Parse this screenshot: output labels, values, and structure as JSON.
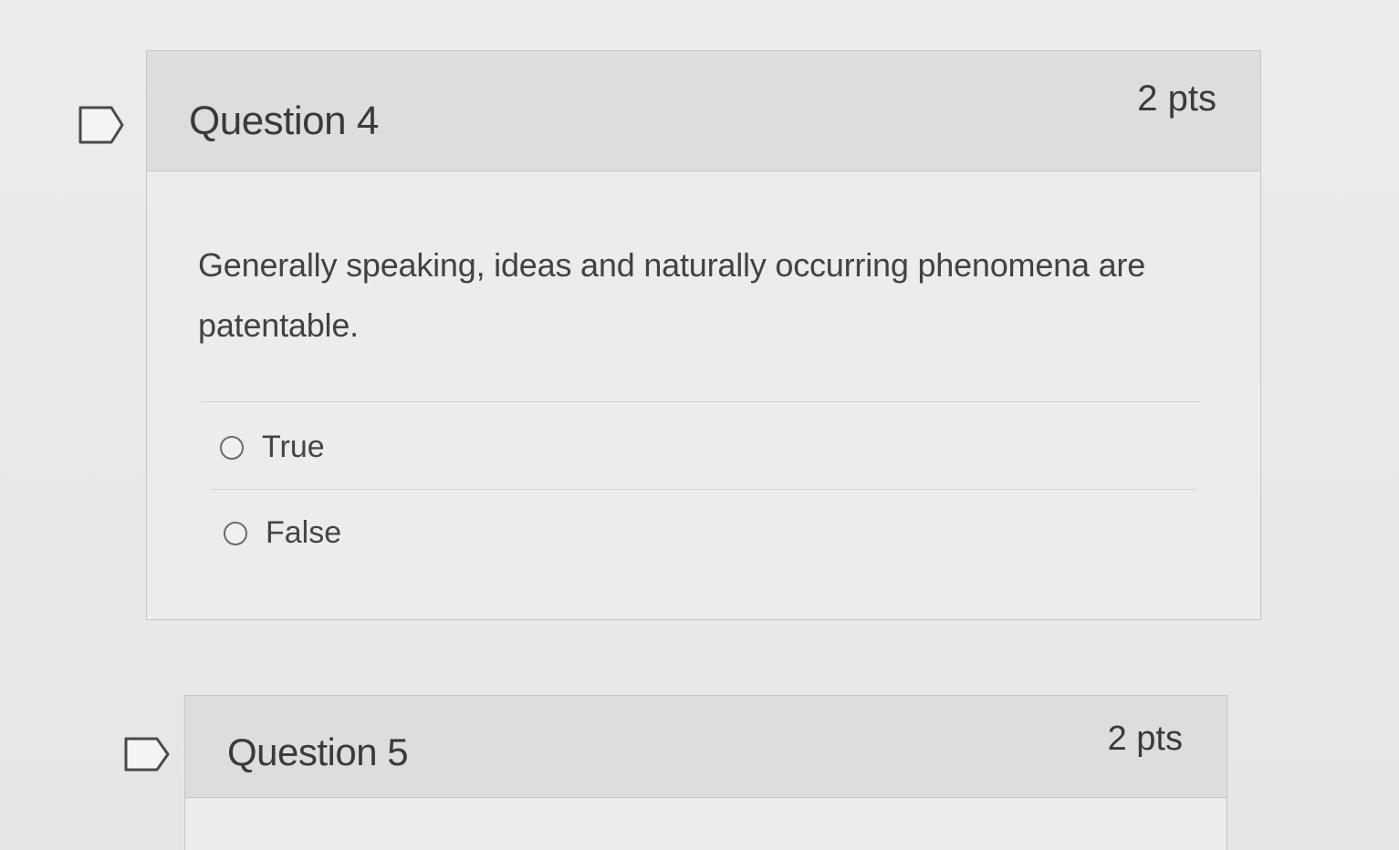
{
  "questions": [
    {
      "title": "Question 4",
      "points": "2 pts",
      "text": "Generally speaking, ideas and naturally occurring phenomena are patentable.",
      "answers": [
        {
          "label": "True",
          "selected": false
        },
        {
          "label": "False",
          "selected": false
        }
      ]
    },
    {
      "title": "Question 5",
      "points": "2 pts"
    }
  ],
  "icons": {
    "flag": "flag-question-icon",
    "radio": "radio-button-icon"
  },
  "colors": {
    "header_bg": "#dddddc",
    "body_bg": "#ececeb",
    "border": "#c6c6c6",
    "text": "#3a3a3a"
  }
}
